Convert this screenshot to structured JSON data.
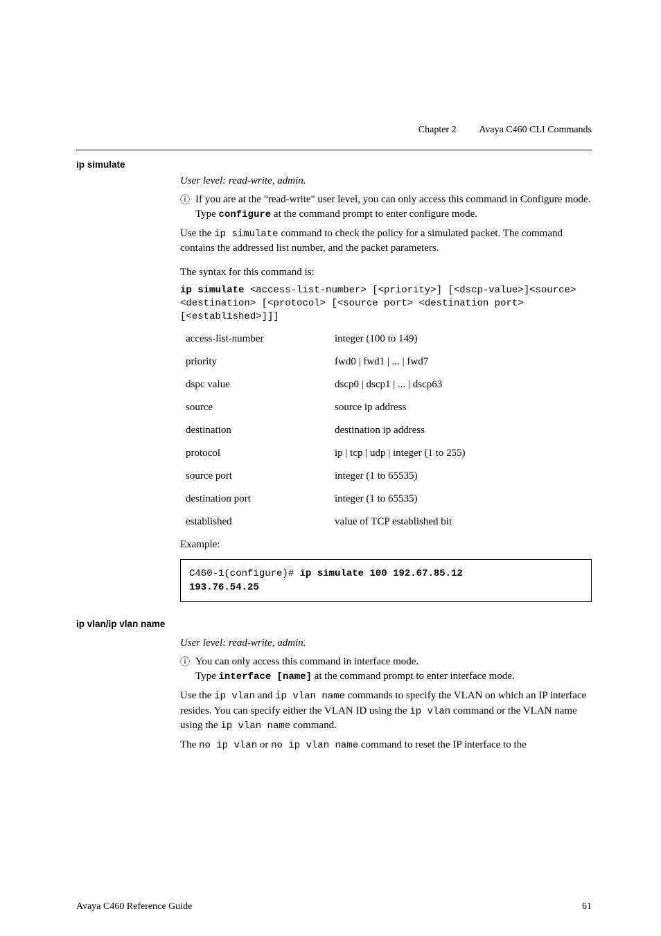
{
  "header": {
    "chapter": "Chapter 2",
    "title": "Avaya C460 CLI Commands"
  },
  "section1": {
    "heading": "ip simulate",
    "user_level": "User level: read-write, admin.",
    "info1": "If you are at the \"read-write\" user level, you can only access this command in Configure mode.",
    "info1_sub": " at the command prompt to enter configure mode.",
    "info1_sub_pre": "Type ",
    "info1_sub_cmd": "configure",
    "desc_pre": "Use the ",
    "desc_code": "ip simulate",
    "desc_post": " command to check the policy for a simulated packet. The command contains the addressed list number, and the packet parameters.",
    "syntax_label": "The syntax for this command is:",
    "syntax_bold": "ip simulate",
    "syntax_rest": " <access-list-number> [<priority>] [<dscp-value>]<source> <destination> [<protocol> [<source port> <destination port> [<established>]]]",
    "params": [
      {
        "name": "access-list-number",
        "desc": "integer (100 to 149)"
      },
      {
        "name": "priority",
        "desc": "fwd0 | fwd1 | ... | fwd7"
      },
      {
        "name": "dspc value",
        "desc": "dscp0 | dscp1 | ... | dscp63"
      },
      {
        "name": "source",
        "desc": "source ip address"
      },
      {
        "name": "destination",
        "desc": "destination ip address"
      },
      {
        "name": "protocol",
        "desc": "ip | tcp | udp | integer (1 to 255)"
      },
      {
        "name": "source port",
        "desc": "integer (1 to 65535)"
      },
      {
        "name": "destination port",
        "desc": "integer (1 to 65535)"
      },
      {
        "name": "established",
        "desc": "value of TCP established bit"
      }
    ],
    "example_label": "Example:",
    "example_prompt": "C460-1(configure)# ",
    "example_bold1": "ip simulate 100 192.67.85.12",
    "example_bold2": "193.76.54.25"
  },
  "section2": {
    "heading": "ip vlan/ip vlan name",
    "user_level": "User level: read-write, admin.",
    "info1": "You can only access this command in interface mode.",
    "info1_sub_pre": "Type ",
    "info1_sub_cmd": "interface [name]",
    "info1_sub_post": " at the command prompt to enter interface mode.",
    "desc_p1_pre": "Use the ",
    "desc_p1_c1": "ip vlan",
    "desc_p1_mid1": " and ",
    "desc_p1_c2": "ip vlan name",
    "desc_p1_mid2": " commands to specify the VLAN on which an IP interface resides. You can specify either the VLAN ID using the ",
    "desc_p1_c3": "ip vlan",
    "desc_p1_mid3": " command or the VLAN name using the ",
    "desc_p1_c4": "ip vlan name",
    "desc_p1_end": " command.",
    "desc_p2_pre": "The ",
    "desc_p2_c1": "no ip vlan",
    "desc_p2_mid1": " or ",
    "desc_p2_c2": "no ip vlan name",
    "desc_p2_end": " command to reset the IP interface to the"
  },
  "footer": {
    "left": "Avaya C460 Reference Guide",
    "right": "61"
  }
}
